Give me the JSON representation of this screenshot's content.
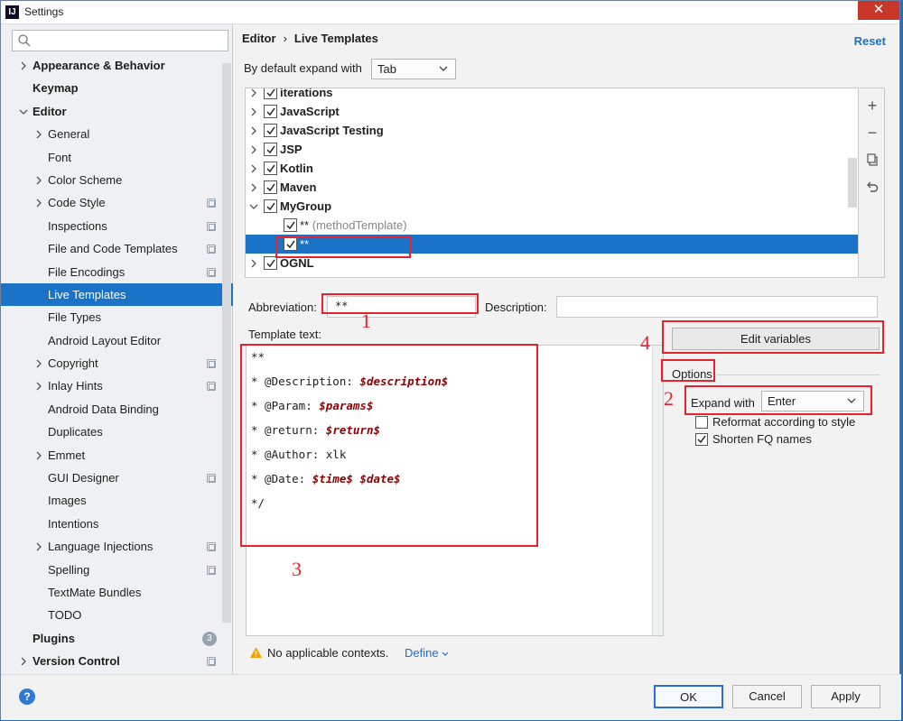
{
  "window": {
    "title": "Settings",
    "app_icon": "IJ",
    "close_icon": "✕"
  },
  "sidebar": {
    "search_placeholder": "",
    "items": [
      {
        "label": "Appearance & Behavior",
        "indent": 0,
        "arrow": "right",
        "bold": true
      },
      {
        "label": "Keymap",
        "indent": 0,
        "arrow": "none",
        "bold": true
      },
      {
        "label": "Editor",
        "indent": 0,
        "arrow": "down",
        "bold": true
      },
      {
        "label": "General",
        "indent": 1,
        "arrow": "right"
      },
      {
        "label": "Font",
        "indent": 1,
        "arrow": "none"
      },
      {
        "label": "Color Scheme",
        "indent": 1,
        "arrow": "right"
      },
      {
        "label": "Code Style",
        "indent": 1,
        "arrow": "right",
        "copy": true
      },
      {
        "label": "Inspections",
        "indent": 1,
        "arrow": "none",
        "copy": true
      },
      {
        "label": "File and Code Templates",
        "indent": 1,
        "arrow": "none",
        "copy": true
      },
      {
        "label": "File Encodings",
        "indent": 1,
        "arrow": "none",
        "copy": true
      },
      {
        "label": "Live Templates",
        "indent": 1,
        "arrow": "none",
        "selected": true
      },
      {
        "label": "File Types",
        "indent": 1,
        "arrow": "none"
      },
      {
        "label": "Android Layout Editor",
        "indent": 1,
        "arrow": "none"
      },
      {
        "label": "Copyright",
        "indent": 1,
        "arrow": "right",
        "copy": true
      },
      {
        "label": "Inlay Hints",
        "indent": 1,
        "arrow": "right",
        "copy": true
      },
      {
        "label": "Android Data Binding",
        "indent": 1,
        "arrow": "none"
      },
      {
        "label": "Duplicates",
        "indent": 1,
        "arrow": "none"
      },
      {
        "label": "Emmet",
        "indent": 1,
        "arrow": "right"
      },
      {
        "label": "GUI Designer",
        "indent": 1,
        "arrow": "none",
        "copy": true
      },
      {
        "label": "Images",
        "indent": 1,
        "arrow": "none"
      },
      {
        "label": "Intentions",
        "indent": 1,
        "arrow": "none"
      },
      {
        "label": "Language Injections",
        "indent": 1,
        "arrow": "right",
        "copy": true
      },
      {
        "label": "Spelling",
        "indent": 1,
        "arrow": "none",
        "copy": true
      },
      {
        "label": "TextMate Bundles",
        "indent": 1,
        "arrow": "none"
      },
      {
        "label": "TODO",
        "indent": 1,
        "arrow": "none"
      },
      {
        "label": "Plugins",
        "indent": 0,
        "arrow": "none",
        "bold": true,
        "badge": "3"
      },
      {
        "label": "Version Control",
        "indent": 0,
        "arrow": "right",
        "bold": true,
        "copy": true
      }
    ]
  },
  "header": {
    "crumb1": "Editor",
    "crumb_sep": "›",
    "crumb2": "Live Templates",
    "reset": "Reset"
  },
  "expand_default": {
    "label": "By default expand with",
    "value": "Tab"
  },
  "template_list": [
    {
      "name": "iterations",
      "checked": true,
      "level": 0,
      "bold": true
    },
    {
      "name": "JavaScript",
      "checked": true,
      "level": 0,
      "bold": true
    },
    {
      "name": "JavaScript Testing",
      "checked": true,
      "level": 0,
      "bold": true
    },
    {
      "name": "JSP",
      "checked": true,
      "level": 0,
      "bold": true
    },
    {
      "name": "Kotlin",
      "checked": true,
      "level": 0,
      "bold": true
    },
    {
      "name": "Maven",
      "checked": true,
      "level": 0,
      "bold": true
    },
    {
      "name": "MyGroup",
      "checked": true,
      "level": 0,
      "bold": true,
      "expanded": true
    },
    {
      "name": "**",
      "desc": "(methodTemplate)",
      "checked": true,
      "level": 1
    },
    {
      "name": "**",
      "checked": true,
      "level": 1,
      "selected": true
    },
    {
      "name": "OGNL",
      "checked": true,
      "level": 0,
      "bold": true
    }
  ],
  "list_tools": {
    "add": "+",
    "remove": "−",
    "copy": "copy-icon",
    "revert": "undo-icon"
  },
  "abbreviation": {
    "label": "Abbreviation:",
    "value": "**"
  },
  "description": {
    "label": "Description:",
    "value": ""
  },
  "template_text": {
    "label": "Template text:",
    "lines": [
      [
        {
          "t": "**"
        }
      ],
      [
        {
          "t": "* @Description: "
        },
        {
          "v": "$description$"
        }
      ],
      [
        {
          "t": "* @Param: "
        },
        {
          "v": "$params$"
        }
      ],
      [
        {
          "t": "* @return: "
        },
        {
          "v": "$return$"
        }
      ],
      [
        {
          "t": "* @Author: xlk"
        }
      ],
      [
        {
          "t": "* @Date: "
        },
        {
          "v": "$time$"
        },
        {
          "t": " "
        },
        {
          "v": "$date$"
        }
      ],
      [
        {
          "t": "*/"
        }
      ]
    ]
  },
  "edit_variables": "Edit variables",
  "options": {
    "title": "Options",
    "expand_with_label": "Expand with",
    "expand_with_value": "Enter",
    "reformat": {
      "label": "Reformat according to style",
      "checked": false
    },
    "shorten": {
      "label": "Shorten FQ names",
      "checked": true
    }
  },
  "contexts": {
    "warning": "No applicable contexts.",
    "define": "Define"
  },
  "footer": {
    "help": "?",
    "ok": "OK",
    "cancel": "Cancel",
    "apply": "Apply"
  },
  "annotations": {
    "n1": "1",
    "n2": "2",
    "n3": "3",
    "n4": "4"
  },
  "colors": {
    "selection": "#1a73c6",
    "link": "#2370c8",
    "annotation": "#e8222c",
    "template_var": "#8b0000"
  }
}
